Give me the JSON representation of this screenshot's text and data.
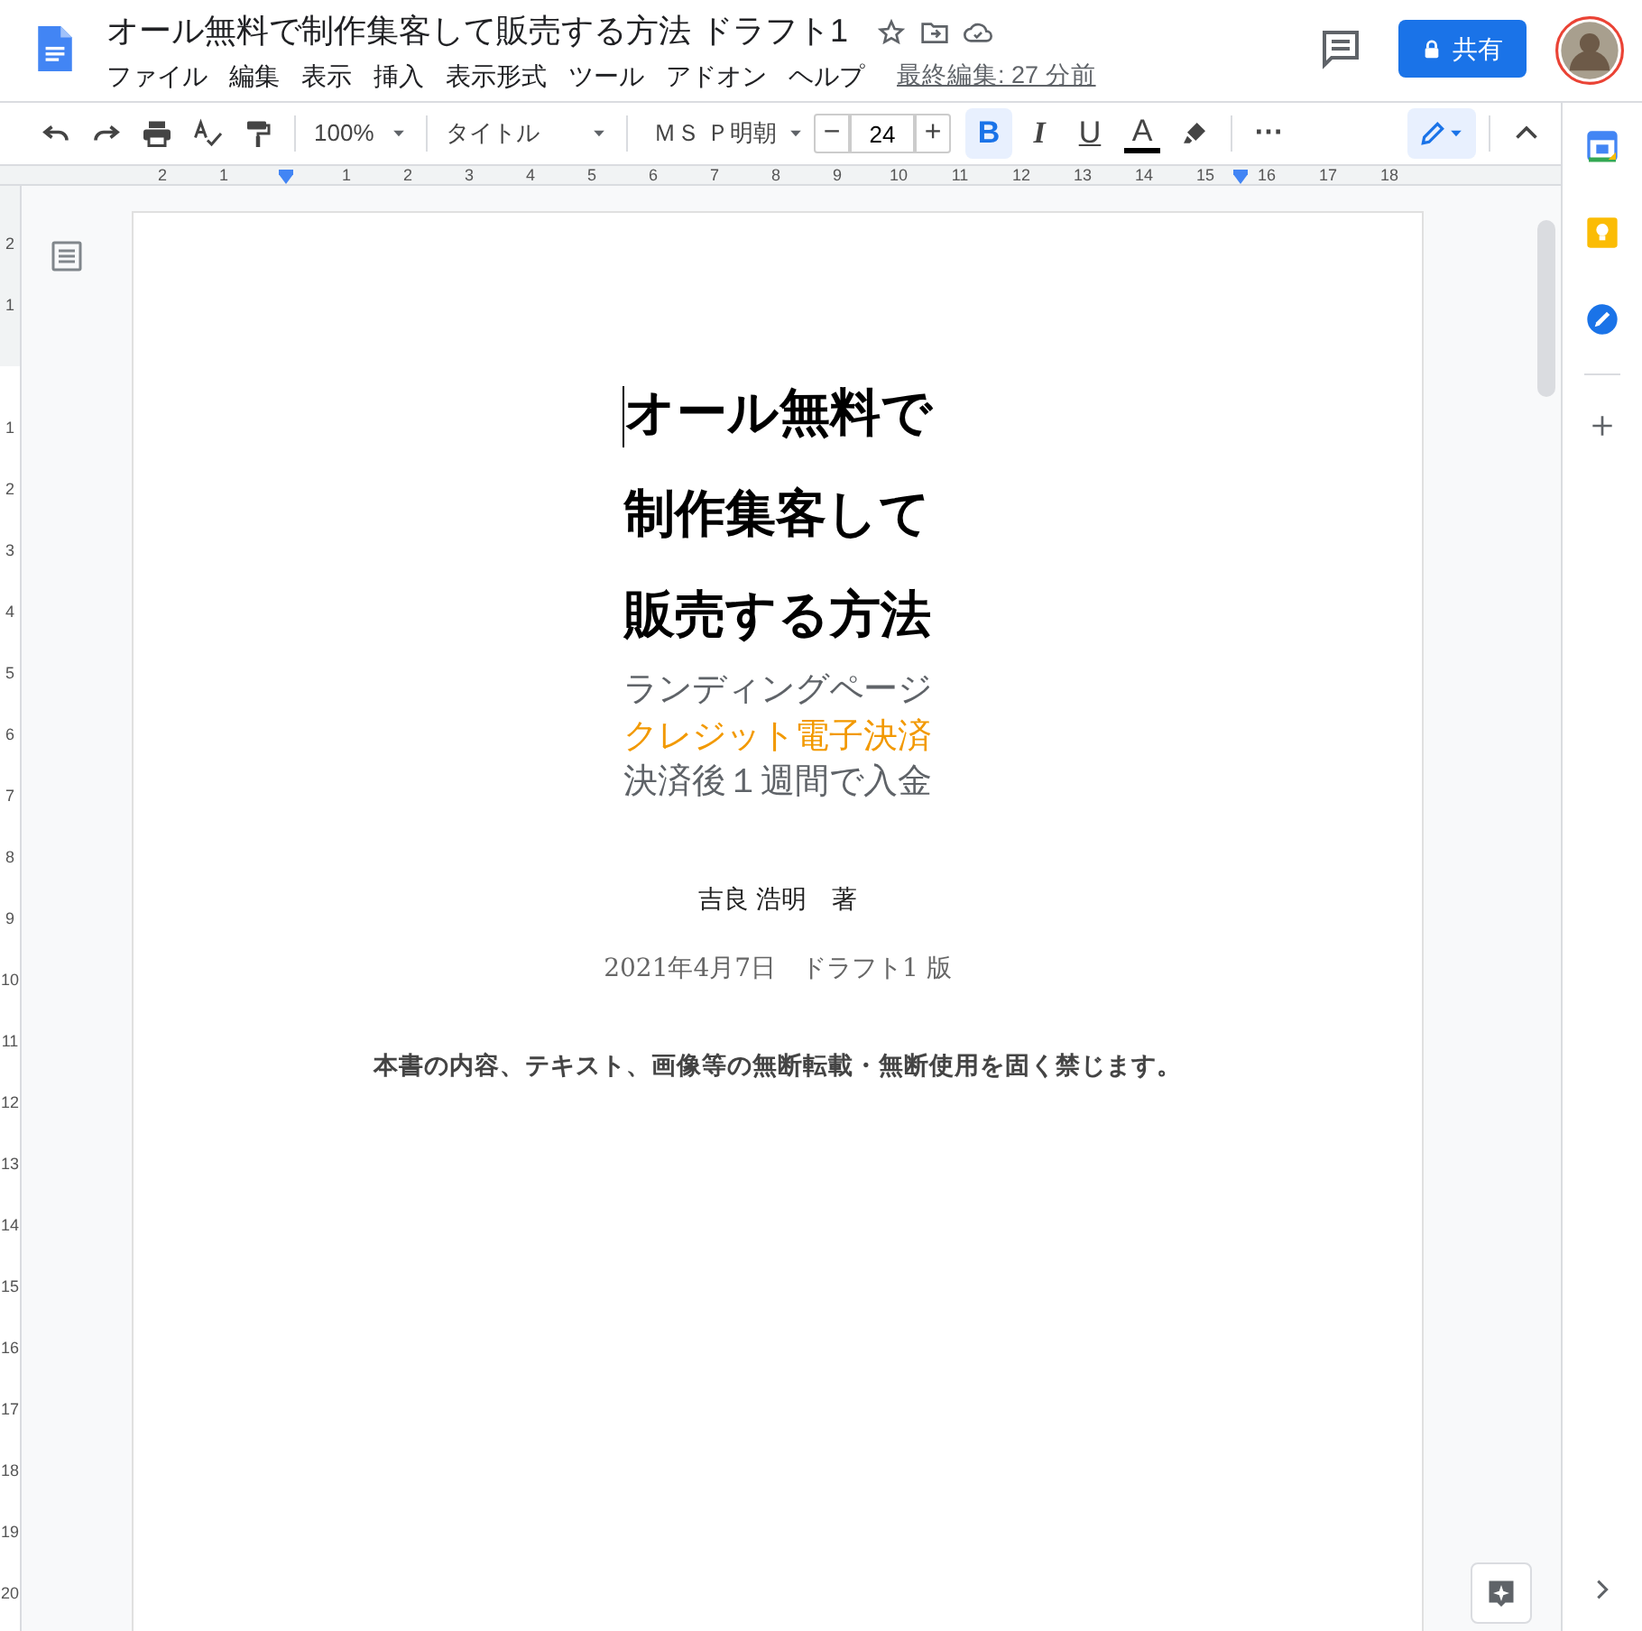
{
  "header": {
    "title": "オール無料で制作集客して販売する方法 ドラフト1",
    "menu": [
      "ファイル",
      "編集",
      "表示",
      "挿入",
      "表示形式",
      "ツール",
      "アドオン",
      "ヘルプ"
    ],
    "last_edit": "最終編集: 27 分前",
    "share_label": "共有"
  },
  "toolbar": {
    "zoom": "100%",
    "style": "タイトル",
    "font": "ＭＳ Ｐ明朝",
    "font_size": "24",
    "minus": "−",
    "plus": "+",
    "format_buttons": [
      {
        "label": "B",
        "selected": true
      },
      {
        "label": "I",
        "selected": false
      },
      {
        "label": "U",
        "selected": false
      }
    ],
    "text_color_label": "A",
    "more": "⋯"
  },
  "ruler": {
    "labels": [
      "2",
      "1",
      "1",
      "2",
      "3",
      "4",
      "5",
      "6",
      "7",
      "8",
      "9",
      "10",
      "11",
      "12",
      "13",
      "14",
      "15",
      "16",
      "17",
      "18"
    ]
  },
  "vertical_ruler": {
    "labels": [
      "2",
      "1",
      "1",
      "2",
      "3",
      "4",
      "5",
      "6",
      "7",
      "8",
      "9",
      "10",
      "11",
      "12",
      "13",
      "14",
      "15",
      "16",
      "17",
      "18",
      "19",
      "20"
    ]
  },
  "document": {
    "title_lines": [
      "オール無料で",
      "制作集客して",
      "販売する方法"
    ],
    "subtitle_lines": [
      {
        "text": "ランディングページ",
        "color": "#5f6368"
      },
      {
        "text": "クレジット電子決済",
        "color": "#f29900"
      },
      {
        "text": "決済後１週間で入金",
        "color": "#5f6368"
      }
    ],
    "author": "吉良 浩明　著",
    "date": "2021年4月7日　ドラフト1 版",
    "notice": "本書の内容、テキスト、画像等の無断転載・無断使用を固く禁じます。"
  }
}
